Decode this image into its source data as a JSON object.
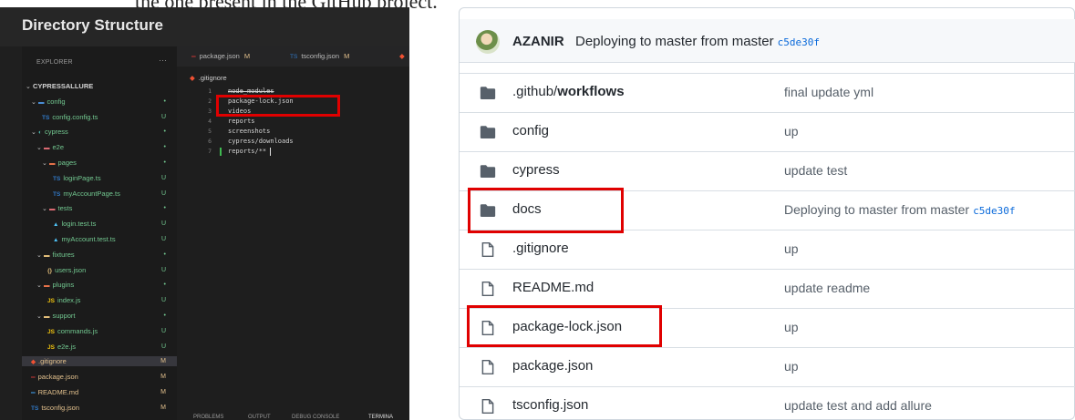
{
  "page": {
    "top_cutoff_text": "the one present in the GitHub project."
  },
  "vscode": {
    "header_title": "Directory Structure",
    "explorer_title": "EXPLORER",
    "explorer_menu": "···",
    "colors": {
      "modified": "#e2c08d",
      "untracked": "#73c991",
      "folder_chevron": "#c5c5c5"
    },
    "tree": [
      {
        "label": "CYPRESSALLURE",
        "icon": "chevron-down",
        "indent": 0,
        "status": "",
        "color": "#d4d4d4",
        "bold": true,
        "selected": false
      },
      {
        "label": "config",
        "icon": "folder-config-icon",
        "indent": 1,
        "status": "•",
        "color": "#73c991",
        "selected": false
      },
      {
        "label": "config.config.ts",
        "icon": "typescript-file-icon",
        "indent": 3,
        "status": "U",
        "color": "#73c991",
        "selected": false
      },
      {
        "label": "cypress",
        "icon": "folder-cypress-icon",
        "indent": 1,
        "status": "•",
        "color": "#73c991",
        "selected": false
      },
      {
        "label": "e2e",
        "icon": "folder-e2e-icon",
        "indent": 2,
        "status": "•",
        "color": "#73c991",
        "selected": false
      },
      {
        "label": "pages",
        "icon": "folder-pages-icon",
        "indent": 3,
        "status": "•",
        "color": "#73c991",
        "selected": false
      },
      {
        "label": "loginPage.ts",
        "icon": "typescript-file-icon",
        "indent": 5,
        "status": "U",
        "color": "#73c991",
        "selected": false
      },
      {
        "label": "myAccountPage.ts",
        "icon": "typescript-file-icon",
        "indent": 5,
        "status": "U",
        "color": "#73c991",
        "selected": false
      },
      {
        "label": "tests",
        "icon": "folder-tests-icon",
        "indent": 3,
        "status": "•",
        "color": "#73c991",
        "selected": false
      },
      {
        "label": "login.test.ts",
        "icon": "test-file-icon",
        "indent": 5,
        "status": "U",
        "color": "#73c991",
        "selected": false
      },
      {
        "label": "myAccount.test.ts",
        "icon": "test-file-icon",
        "indent": 5,
        "status": "U",
        "color": "#73c991",
        "selected": false
      },
      {
        "label": "fixtures",
        "icon": "folder-fixtures-icon",
        "indent": 2,
        "status": "•",
        "color": "#73c991",
        "selected": false
      },
      {
        "label": "users.json",
        "icon": "json-file-icon",
        "indent": 4,
        "status": "U",
        "color": "#73c991",
        "selected": false
      },
      {
        "label": "plugins",
        "icon": "folder-plugins-icon",
        "indent": 2,
        "status": "•",
        "color": "#73c991",
        "selected": false
      },
      {
        "label": "index.js",
        "icon": "javascript-file-icon",
        "indent": 4,
        "status": "U",
        "color": "#73c991",
        "selected": false
      },
      {
        "label": "support",
        "icon": "folder-support-icon",
        "indent": 2,
        "status": "•",
        "color": "#73c991",
        "selected": false
      },
      {
        "label": "commands.js",
        "icon": "javascript-file-icon",
        "indent": 4,
        "status": "U",
        "color": "#73c991",
        "selected": false
      },
      {
        "label": "e2e.js",
        "icon": "javascript-file-icon",
        "indent": 4,
        "status": "U",
        "color": "#73c991",
        "selected": false
      },
      {
        "label": ".gitignore",
        "icon": "git-file-icon",
        "indent": 1,
        "status": "M",
        "color": "#e2c08d",
        "selected": true
      },
      {
        "label": "package.json",
        "icon": "npm-file-icon",
        "indent": 1,
        "status": "M",
        "color": "#e2c08d",
        "selected": false
      },
      {
        "label": "README.md",
        "icon": "markdown-file-icon",
        "indent": 1,
        "status": "M",
        "color": "#e2c08d",
        "selected": false
      },
      {
        "label": "tsconfig.json",
        "icon": "tsconfig-file-icon",
        "indent": 1,
        "status": "M",
        "color": "#e2c08d",
        "selected": false
      }
    ],
    "tabs": [
      {
        "label": "package.json",
        "status": "M",
        "icon": "npm-file-icon"
      },
      {
        "label": "tsconfig.json",
        "status": "M",
        "icon": "tsconfig-file-icon"
      }
    ],
    "breadcrumb": ".gitignore",
    "code_lines": [
      {
        "num": "1",
        "text": "node_modules",
        "strike": true
      },
      {
        "num": "2",
        "text": "package-lock.json",
        "strike": false
      },
      {
        "num": "3",
        "text": "videos",
        "strike": false
      },
      {
        "num": "4",
        "text": "reports",
        "strike": false
      },
      {
        "num": "5",
        "text": "screenshots",
        "strike": false
      },
      {
        "num": "6",
        "text": "cypress/downloads",
        "strike": false
      },
      {
        "num": "7",
        "text": "reports/**",
        "strike": false
      }
    ],
    "panel_tabs": [
      "PROBLEMS",
      "OUTPUT",
      "DEBUG CONSOLE",
      "TERMINA"
    ]
  },
  "github": {
    "author": "AZANIR",
    "commit_message": "Deploying to master from master",
    "commit_sha": "c5de30f",
    "rows": [
      {
        "type": "folder",
        "name_prefix": ".github/",
        "name": "workflows",
        "message": "final update yml",
        "sha": ""
      },
      {
        "type": "folder",
        "name_prefix": "",
        "name": "config",
        "message": "up",
        "sha": ""
      },
      {
        "type": "folder",
        "name_prefix": "",
        "name": "cypress",
        "message": "update test",
        "sha": ""
      },
      {
        "type": "folder",
        "name_prefix": "",
        "name": "docs",
        "message": "Deploying to master from master",
        "sha": "c5de30f"
      },
      {
        "type": "file",
        "name_prefix": "",
        "name": ".gitignore",
        "message": "up",
        "sha": ""
      },
      {
        "type": "file",
        "name_prefix": "",
        "name": "README.md",
        "message": "update readme",
        "sha": ""
      },
      {
        "type": "file",
        "name_prefix": "",
        "name": "package-lock.json",
        "message": "up",
        "sha": ""
      },
      {
        "type": "file",
        "name_prefix": "",
        "name": "package.json",
        "message": "up",
        "sha": ""
      },
      {
        "type": "file",
        "name_prefix": "",
        "name": "tsconfig.json",
        "message": "update test and add allure",
        "sha": ""
      }
    ]
  },
  "colors": {
    "highlight_box": "#e00000",
    "github_link_blue": "#0969da",
    "folder_icon": "#57606a"
  }
}
